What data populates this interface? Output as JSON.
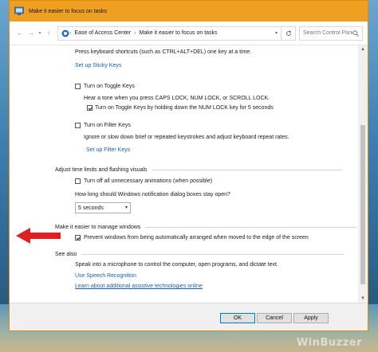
{
  "window": {
    "title": "Make it easier to focus on tasks"
  },
  "address": {
    "breadcrumb": [
      "Ease of Access Center",
      "Make it easier to focus on tasks"
    ],
    "search_placeholder": "Search Control Panel"
  },
  "keyboard": {
    "sticky_desc": "Press keyboard shortcuts (such as CTRL+ALT+DEL) one key at a time.",
    "sticky_link": "Set up Sticky Keys",
    "toggle_label": "Turn on Toggle Keys",
    "toggle_checked": false,
    "toggle_desc": "Hear a tone when you press CAPS LOCK, NUM LOCK, or SCROLL LOCK.",
    "toggle_hold_label": "Turn on Toggle Keys by holding down the NUM LOCK key for 5 seconds",
    "toggle_hold_checked": true,
    "filter_label": "Turn on Filter Keys",
    "filter_checked": false,
    "filter_desc": "Ignore or slow down brief or repeated keystrokes and adjust keyboard repeat rates.",
    "filter_link": "Set up Filter Keys"
  },
  "time_limits": {
    "heading": "Adjust time limits and flashing visuals",
    "animations_label": "Turn off all unnecessary animations (when possible)",
    "animations_checked": false,
    "notification_question": "How long should Windows notification dialog boxes stay open?",
    "notification_value": "5 seconds"
  },
  "manage_windows": {
    "heading": "Make it easier to manage windows",
    "prevent_label": "Prevent windows from being automatically arranged when moved to the edge of the screen",
    "prevent_checked": true
  },
  "see_also": {
    "heading": "See also",
    "speech_desc": "Speak into a microphone to control the computer, open programs, and dictate text.",
    "speech_link": "Use Speech Recognition",
    "learn_link": "Learn about additional assistive technologies online"
  },
  "footer": {
    "ok": "OK",
    "cancel": "Cancel",
    "apply": "Apply"
  },
  "watermark": "WinBuzzer",
  "colors": {
    "titlebar": "#f0a020",
    "link": "#1a5fb4",
    "arrow": "#e02020"
  },
  "icons": [
    "control-panel-icon",
    "back-arrow-icon",
    "forward-arrow-icon",
    "chevron-down-icon",
    "up-arrow-icon",
    "refresh-icon",
    "search-icon",
    "red-arrow-icon"
  ]
}
